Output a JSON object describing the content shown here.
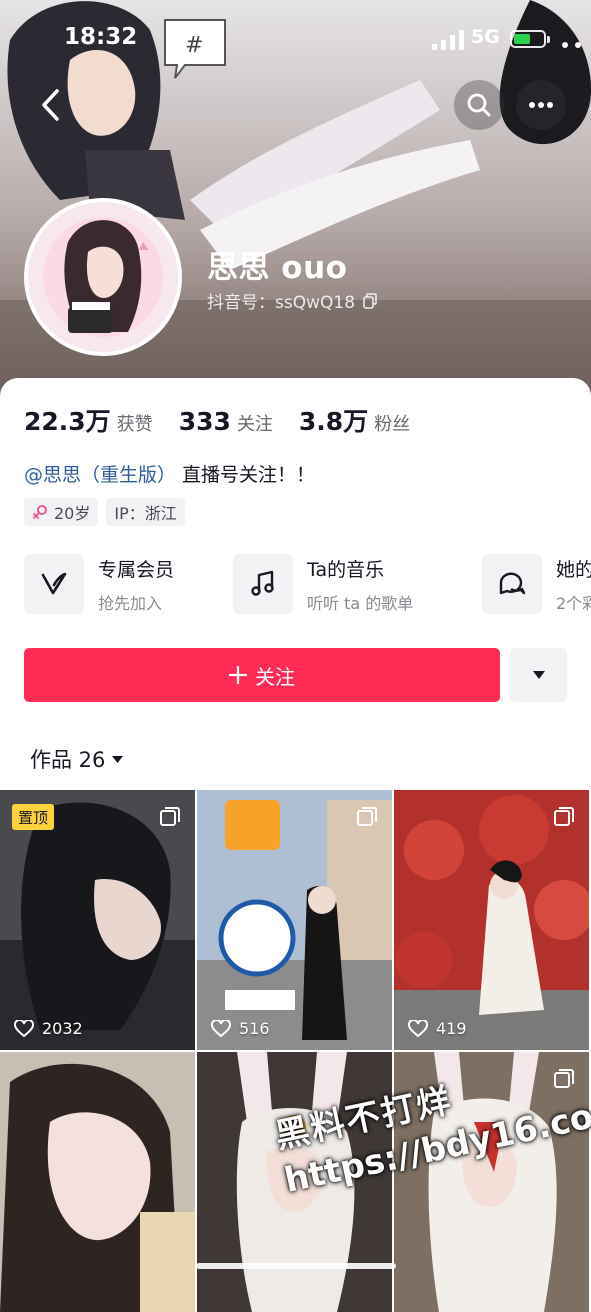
{
  "status_bar": {
    "time": "18:32",
    "network": "5G"
  },
  "profile": {
    "name": "思思 ouo",
    "douyin_id": "抖音号：ssQwQ18"
  },
  "stats": {
    "likes_num": "22.3万",
    "likes_label": "获赞",
    "following_num": "333",
    "following_label": "关注",
    "fans_num": "3.8万",
    "fans_label": "粉丝"
  },
  "bio": {
    "mention": "@思思（重生版）",
    "text": " 直播号关注！！"
  },
  "tags": {
    "age": "20岁",
    "ip": "IP：浙江"
  },
  "features": [
    {
      "title": "专属会员",
      "subtitle": "抢先加入",
      "icon": "vip-v-icon"
    },
    {
      "title": "Ta的音乐",
      "subtitle": "听听 ta 的歌单",
      "icon": "music-note-icon"
    },
    {
      "title": "她的",
      "subtitle": "2个彩",
      "icon": "chat-bubble-icon"
    }
  ],
  "actions": {
    "follow_label": "关注"
  },
  "works": {
    "label": "作品 26"
  },
  "grid": {
    "pinned_label": "置顶",
    "tiles": [
      {
        "likes": "2032"
      },
      {
        "likes": "516"
      },
      {
        "likes": "419"
      },
      {
        "likes": ""
      },
      {
        "likes": ""
      },
      {
        "likes": ""
      }
    ]
  },
  "watermark": {
    "line1": "黑料不打烊",
    "line2": "https://bdy16.co"
  },
  "colors": {
    "accent": "#fe2c55",
    "mention": "#2f5c9e",
    "pin": "#fbd23b"
  }
}
